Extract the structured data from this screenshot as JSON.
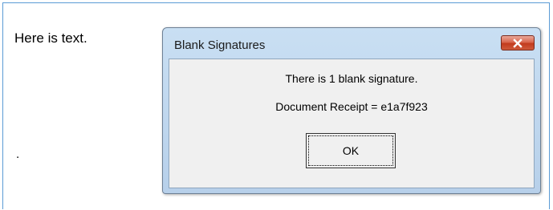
{
  "document": {
    "text": "Here is text.",
    "bullet_char": "."
  },
  "dialog": {
    "title": "Blank Signatures",
    "message_1": "There is 1 blank signature.",
    "message_2": "Document Receipt = e1a7f923",
    "ok_label": "OK",
    "close_icon": "close-x",
    "colors": {
      "close_button": "#c23b1e",
      "frame_border": "#5b9bd5"
    }
  }
}
